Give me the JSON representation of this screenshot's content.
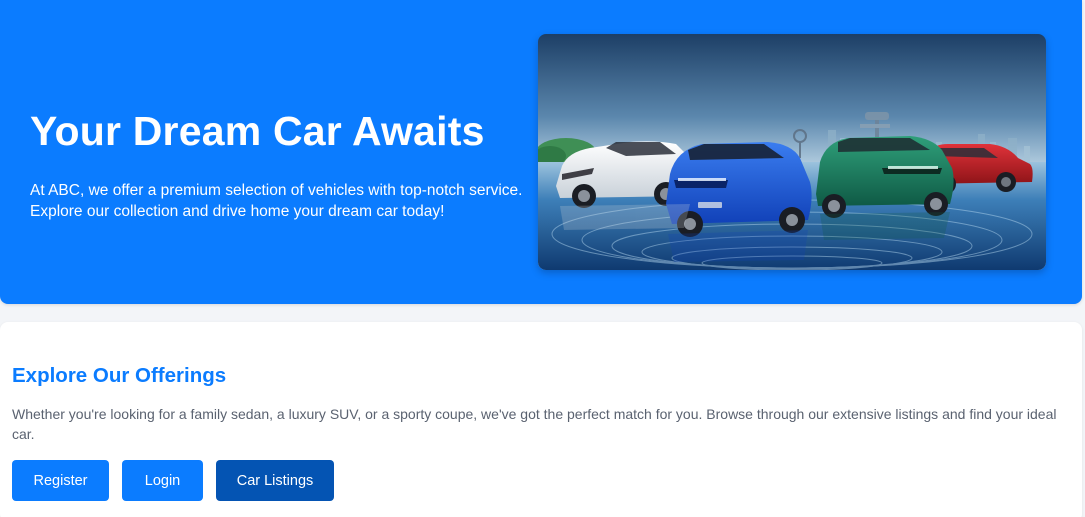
{
  "hero": {
    "title": "Your Dream Car Awaits",
    "description": "At ABC, we offer a premium selection of vehicles with top-notch service. Explore our collection and drive home your dream car today!",
    "image_subject": "lineup of four electric SUVs (white, blue, green, red) in a futuristic blue setting",
    "background_color": "#0b7cff"
  },
  "offerings": {
    "title": "Explore Our Offerings",
    "description": "Whether you're looking for a family sedan, a luxury SUV, or a sporty coupe, we've got the perfect match for you. Browse through our extensive listings and find your ideal car.",
    "buttons": {
      "register": "Register",
      "login": "Login",
      "car_listings": "Car Listings"
    },
    "accent_color": "#0b7cff",
    "active_button_color": "#0454b3"
  }
}
